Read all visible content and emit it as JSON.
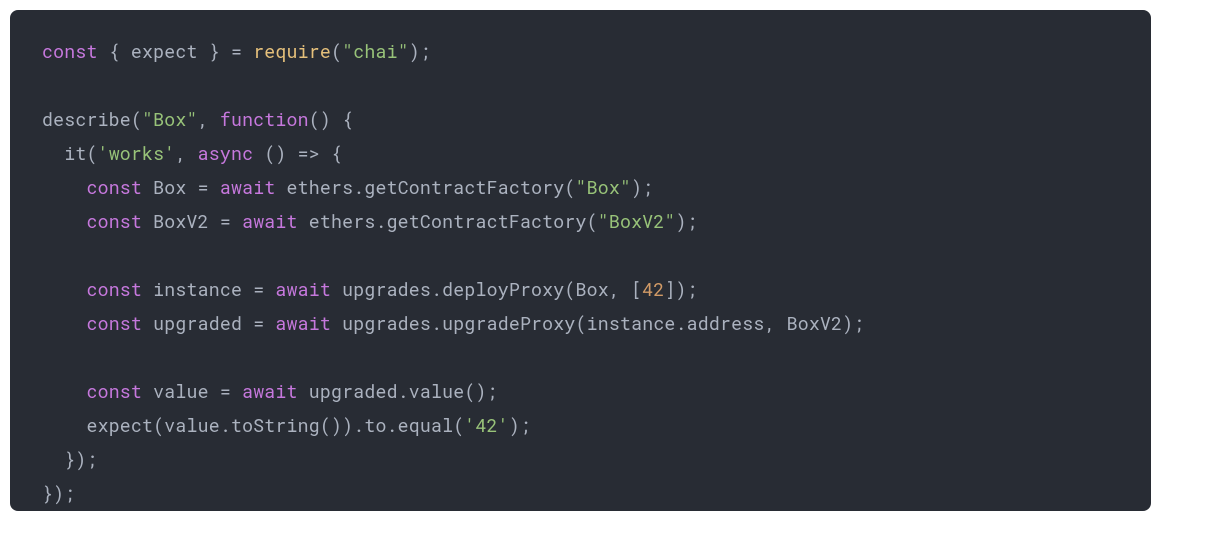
{
  "code": {
    "l1": {
      "const": "const",
      "brace_open": " { ",
      "expect": "expect",
      "brace_close": " } = ",
      "require": "require",
      "paren_open": "(",
      "chai": "\"chai\"",
      "paren_close": ");"
    },
    "l2": "",
    "l3": {
      "describe": "describe(",
      "box": "\"Box\"",
      "comma": ", ",
      "function": "function",
      "rest": "() {"
    },
    "l4": {
      "indent": "  ",
      "it": "it(",
      "works": "'works'",
      "comma": ", ",
      "async": "async",
      "arrow": " () => {"
    },
    "l5": {
      "indent": "    ",
      "const": "const",
      "name": " Box = ",
      "await": "await",
      "rest": " ethers.getContractFactory(",
      "str": "\"Box\"",
      "end": ");"
    },
    "l6": {
      "indent": "    ",
      "const": "const",
      "name": " BoxV2 = ",
      "await": "await",
      "rest": " ethers.getContractFactory(",
      "str": "\"BoxV2\"",
      "end": ");"
    },
    "l7": "",
    "l8": {
      "indent": "    ",
      "const": "const",
      "name": " instance = ",
      "await": "await",
      "rest": " upgrades.deployProxy(Box, [",
      "num": "42",
      "end": "]);"
    },
    "l9": {
      "indent": "    ",
      "const": "const",
      "name": " upgraded = ",
      "await": "await",
      "rest": " upgrades.upgradeProxy(instance.address, BoxV2);"
    },
    "l10": "",
    "l11": {
      "indent": "    ",
      "const": "const",
      "name": " value = ",
      "await": "await",
      "rest": " upgraded.value();"
    },
    "l12": {
      "indent": "    ",
      "rest1": "expect(value.toString()).to.equal(",
      "str": "'42'",
      "end": ");"
    },
    "l13": "  });",
    "l14": "});"
  }
}
